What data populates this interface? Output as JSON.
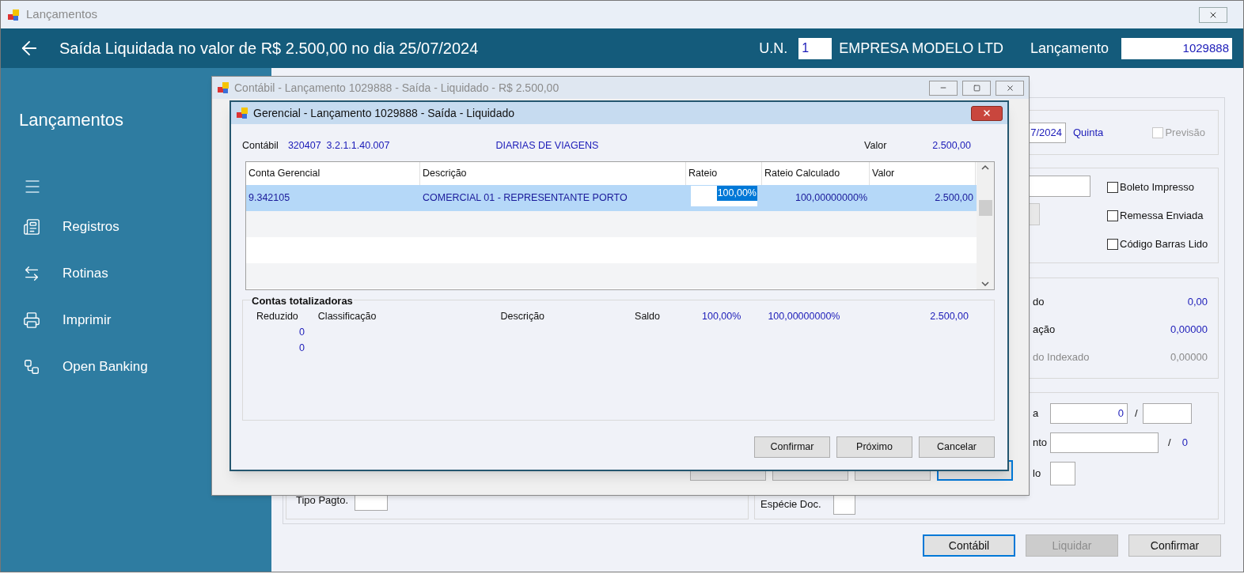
{
  "window": {
    "title": "Lançamentos"
  },
  "header": {
    "title": "Saída Liquidada no valor de R$ 2.500,00 no dia 25/07/2024",
    "un_label": "U.N.",
    "un_value": "1",
    "company": "EMPRESA MODELO LTD",
    "entry_label": "Lançamento",
    "entry_value": "1029888"
  },
  "sidebar": {
    "title": "Lançamentos",
    "items": [
      {
        "label": "Registros",
        "kind": "document"
      },
      {
        "label": "Rotinas",
        "kind": "arrows"
      },
      {
        "label": "Imprimir",
        "kind": "printer"
      },
      {
        "label": "Open Banking",
        "kind": "nodes"
      }
    ]
  },
  "form": {
    "date_value": "7/2024",
    "weekday": "Quinta",
    "forecast": {
      "label": "Previsão",
      "checked": false,
      "disabled": true
    },
    "checkboxes": [
      {
        "label": "Boleto Impresso",
        "checked": false
      },
      {
        "label": "Remessa Enviada",
        "checked": false
      },
      {
        "label": "Código Barras Lido",
        "checked": false
      }
    ],
    "amounts": [
      {
        "label": "do",
        "value": "0,00",
        "disabled": false
      },
      {
        "label": "ação",
        "value": "0,00000",
        "disabled": false
      },
      {
        "label": "do Indexado",
        "value": "0,00000",
        "disabled": true
      }
    ],
    "installment": {
      "label": "a",
      "value": "0",
      "separator": "/"
    },
    "document": {
      "label": "nto",
      "separator": "/",
      "total": "0"
    },
    "row_3": {
      "label": "lo"
    },
    "payment_type": {
      "label": "Tipo Pagto."
    },
    "doc_type": {
      "label": "Espécie Doc."
    },
    "buttons": [
      {
        "label": "Contábil",
        "focused": true,
        "disabled": false
      },
      {
        "label": "Liquidar",
        "focused": false,
        "disabled": true
      },
      {
        "label": "Confirmar",
        "focused": false,
        "disabled": false
      }
    ]
  },
  "contabil_dialog": {
    "title": "Contábil - Lançamento 1029888 - Saída - Liquidado - R$ 2.500,00",
    "buttons": [
      {
        "focused": false
      },
      {
        "focused": false
      },
      {
        "focused": false
      },
      {
        "focused": true
      }
    ]
  },
  "gerencial_dialog": {
    "title": "Gerencial -  Lançamento 1029888 - Saída - Liquidado",
    "account_label": "Contábil",
    "account": "320407  3.2.1.1.40.007",
    "account_description": "DIARIAS DE VIAGENS",
    "value_label": "Valor",
    "value": "2.500,00",
    "grid": {
      "columns": [
        "Conta Gerencial",
        "Descrição",
        "Rateio",
        "Rateio Calculado",
        "Valor"
      ],
      "rows": [
        {
          "cells": [
            "9.342105",
            "COMERCIAL 01 - REPRESENTANTE PORTO",
            "100,00%",
            "100,00000000%",
            "2.500,00"
          ],
          "selected": true
        }
      ]
    },
    "totals": {
      "legend": "Contas totalizadoras",
      "headers": [
        "Reduzido",
        "Classificação",
        "Descrição",
        "Saldo"
      ],
      "sums": [
        "100,00%",
        "100,00000000%",
        "2.500,00"
      ],
      "rows": [
        "0",
        "0"
      ]
    },
    "buttons": [
      "Confirmar",
      "Próximo",
      "Cancelar"
    ]
  }
}
